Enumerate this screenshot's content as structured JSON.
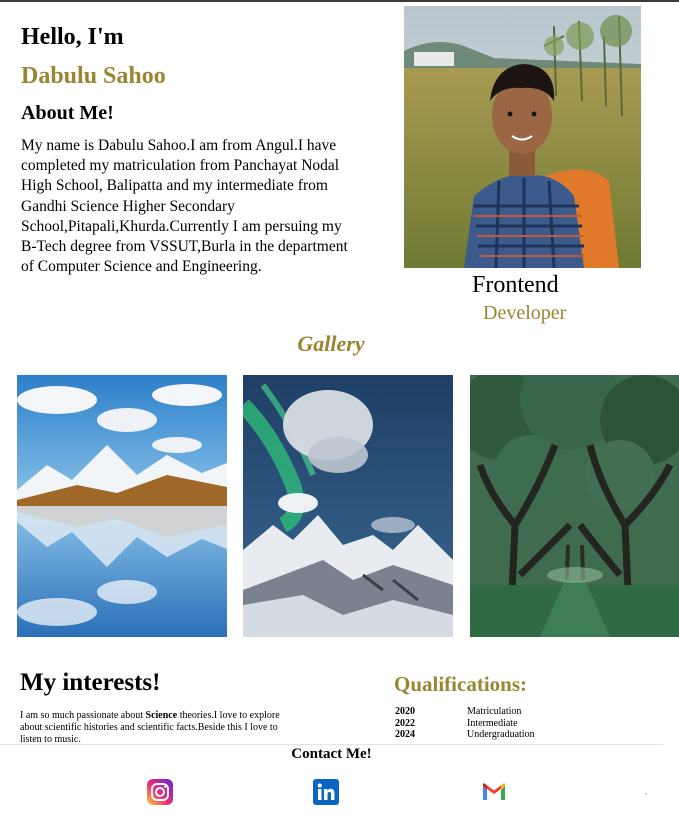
{
  "header": {
    "greeting": "Hello, I'm",
    "name": "Dabulu Sahoo"
  },
  "about": {
    "heading": "About Me!",
    "paragraph": "My name is Dabulu Sahoo.I am from Angul.I have completed my matriculation from Panchayat Nodal High School, Balipatta and my intermediate from Gandhi Science Higher Secondary School,Pitapali,Khurda.Currently I am persuing my B-Tech degree from VSSUT,Burla in the department of Computer Science and Engineering."
  },
  "profile": {
    "role_line1": "Frontend",
    "role_line2": "Developer"
  },
  "gallery": {
    "heading": "Gallery"
  },
  "interests": {
    "heading": "My interests!",
    "text_before": "I am so much passionate about ",
    "text_bold": "Science",
    "text_after": " theories.I love to explore about scientific histories and scientific facts.Beside this I love to listen to music."
  },
  "qualifications": {
    "heading": "Qualifications:",
    "rows": [
      {
        "year": "2020",
        "label": "Matriculation"
      },
      {
        "year": "2022",
        "label": "Intermediate"
      },
      {
        "year": "2024",
        "label": "Undergraduation"
      }
    ]
  },
  "contact": {
    "heading": "Contact Me!",
    "icons": [
      "instagram-icon",
      "linkedin-icon",
      "gmail-icon"
    ]
  },
  "colors": {
    "accent_gold": "#9a8530",
    "linkedin_blue": "#0a66c2"
  }
}
